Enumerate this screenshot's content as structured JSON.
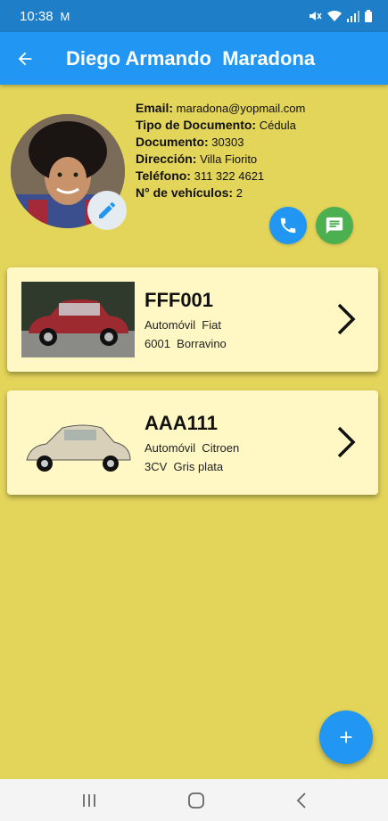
{
  "status_bar": {
    "time": "10:38",
    "mail_glyph": "M"
  },
  "app_bar": {
    "title": "Diego Armando  Maradona"
  },
  "profile": {
    "rows": [
      {
        "label": "Email:",
        "value": "maradona@yopmail.com"
      },
      {
        "label": "Tipo de Documento:",
        "value": "Cédula"
      },
      {
        "label": "Documento:",
        "value": "30303"
      },
      {
        "label": "Dirección:",
        "value": "Villa Fiorito"
      },
      {
        "label": "Teléfono:",
        "value": "311 322 4621"
      },
      {
        "label": "N° de vehículos:",
        "value": "2"
      }
    ]
  },
  "vehicles": [
    {
      "plate": "FFF001",
      "line1": "Automóvil  Fiat",
      "line2": "6001  Borravino",
      "color": "#9c2a30"
    },
    {
      "plate": "AAA111",
      "line1": "Automóvil  Citroen",
      "line2": "3CV  Gris plata",
      "color": "#d8d0b8"
    }
  ],
  "colors": {
    "primary": "#2196f3",
    "background": "#e3d45a",
    "card": "#fff8c4",
    "green": "#4caf50"
  }
}
